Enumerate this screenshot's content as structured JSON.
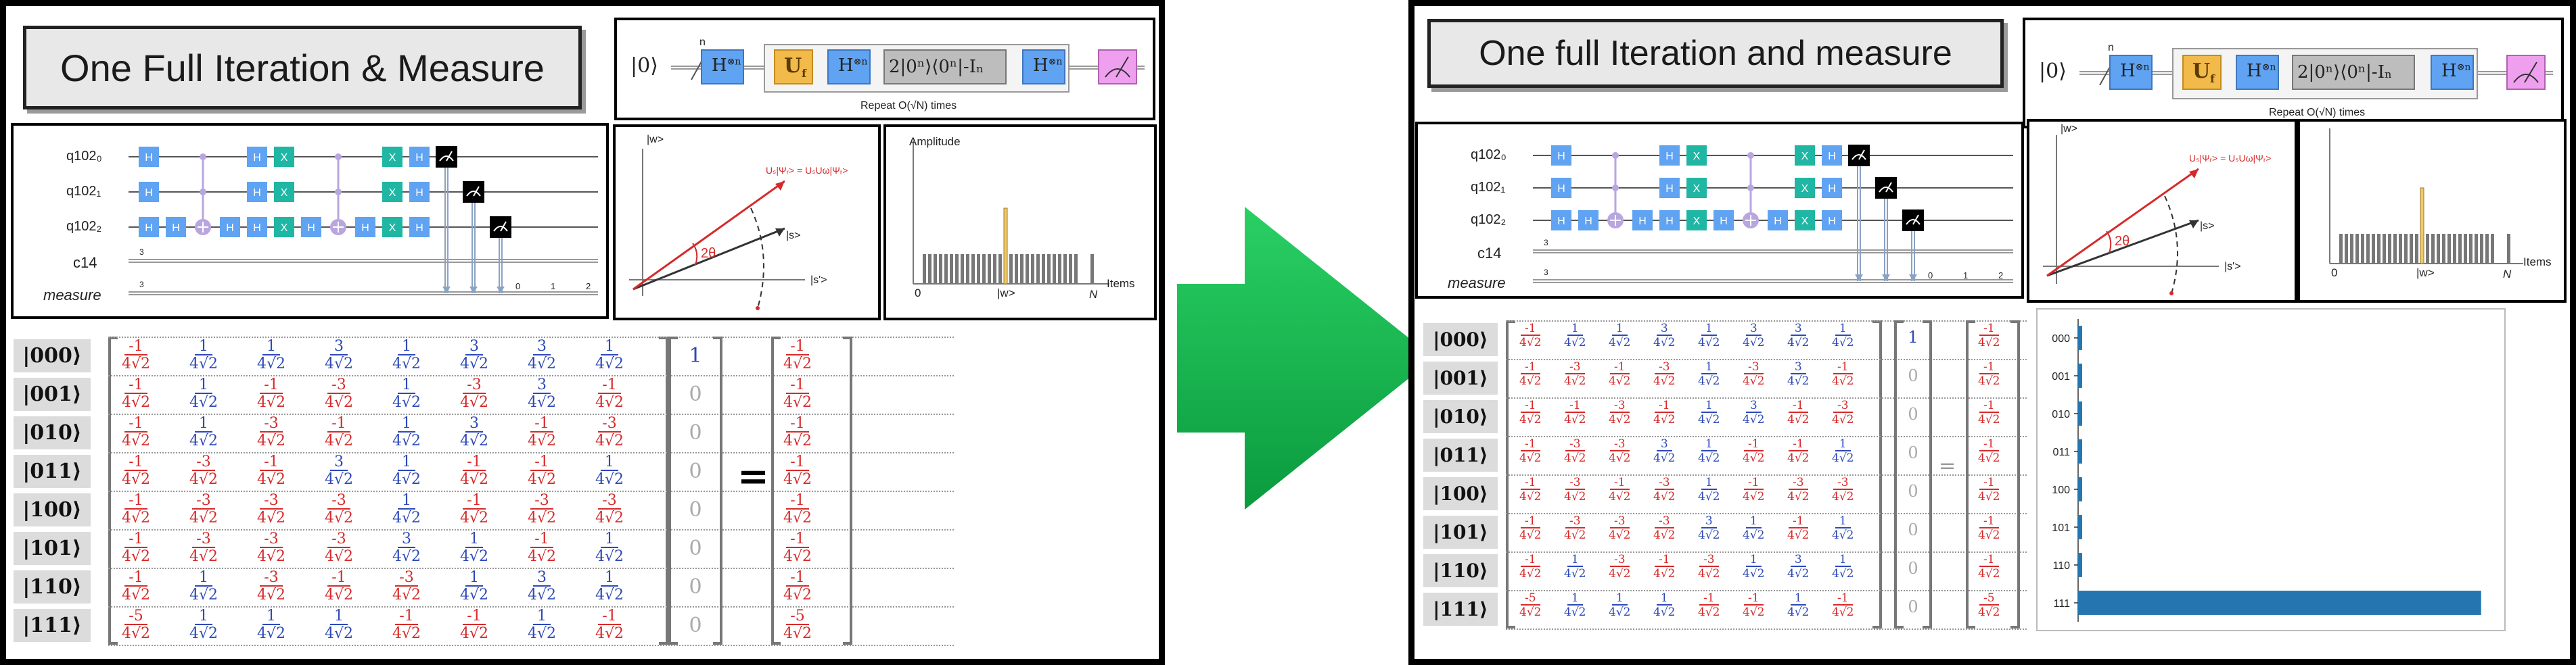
{
  "colors": {
    "arrow": "#12b34c",
    "gate_h": "#5fa3f2",
    "gate_x": "#1fb6a4",
    "uf_gate": "#f2b94b",
    "diffuser": "#bdbdbd",
    "measure_gate": "#eea0ee",
    "negative": "#d62a2a",
    "positive": "#2d49b8",
    "bar": "#2575b0",
    "marked_bar": "#f0c86a"
  },
  "left": {
    "title": "One Full Iteration & Measure",
    "top_circuit": {
      "ket0": "|0⟩",
      "n": "n",
      "h_label": "H",
      "h_sup": "⊗n",
      "uf": "U",
      "uf_sub": "f",
      "diffuser": "2|0ⁿ⟩⟨0ⁿ|-Iₙ",
      "repeat": "Repeat O(√N) times"
    },
    "circuit": {
      "qubits": [
        "q102₀",
        "q102₁",
        "q102₂"
      ],
      "classical": "c14",
      "measure": "measure",
      "bus_width": "3",
      "h": "H",
      "x": "X",
      "bit_labels": [
        "0",
        "1",
        "2"
      ]
    },
    "geometry_plot": {
      "w": "|w>",
      "s": "|s>",
      "s_prime": "|s'>",
      "angle": "2θ",
      "formula": "Uₛ|Ψᵣ> = UₛUω|Ψᵣ>"
    },
    "amplitude_plot": {
      "ylabel": "Amplitude",
      "origin": "0",
      "w_label": "|w>",
      "n_label": "N",
      "items_label": "Items"
    },
    "kets": [
      "|000⟩",
      "|001⟩",
      "|010⟩",
      "|011⟩",
      "|100⟩",
      "|101⟩",
      "|110⟩",
      "|111⟩"
    ],
    "matrix": [
      [
        "-1",
        "1",
        "1",
        "3",
        "1",
        "3",
        "3",
        "1"
      ],
      [
        "-1",
        "1",
        "-1",
        "-3",
        "1",
        "-3",
        "3",
        "-1"
      ],
      [
        "-1",
        "1",
        "-3",
        "-1",
        "1",
        "3",
        "-1",
        "-3"
      ],
      [
        "-1",
        "-3",
        "-1",
        "3",
        "1",
        "-1",
        "-1",
        "1"
      ],
      [
        "-1",
        "-3",
        "-3",
        "-3",
        "1",
        "-1",
        "-3",
        "-3"
      ],
      [
        "-1",
        "-3",
        "-3",
        "-3",
        "3",
        "1",
        "-1",
        "1"
      ],
      [
        "-1",
        "1",
        "-3",
        "-1",
        "-3",
        "1",
        "3",
        "1"
      ],
      [
        "-5",
        "1",
        "1",
        "1",
        "-1",
        "-1",
        "1",
        "-1"
      ]
    ],
    "den": "4√2",
    "vector": [
      "1",
      "0",
      "0",
      "0",
      "0",
      "0",
      "0",
      "0"
    ],
    "equals": "=",
    "result": [
      "-1",
      "-1",
      "-1",
      "-1",
      "-1",
      "-1",
      "-1",
      "-5"
    ]
  },
  "right": {
    "title": "One full Iteration and measure",
    "top_circuit": {
      "ket0": "|0⟩",
      "n": "n",
      "h_label": "H",
      "h_sup": "⊗n",
      "uf": "U",
      "uf_sub": "f",
      "diffuser": "2|0ⁿ⟩⟨0ⁿ|-Iₙ",
      "repeat": "Repeat O(√N) times"
    },
    "circuit": {
      "qubits": [
        "q102₀",
        "q102₁",
        "q102₂"
      ],
      "classical": "c14",
      "measure": "measure",
      "bus_width": "3",
      "h": "H",
      "x": "X",
      "bit_labels": [
        "0",
        "1",
        "2"
      ]
    },
    "geometry_plot": {
      "w": "|w>",
      "s": "|s>",
      "s_prime": "|s'>",
      "angle": "2θ",
      "formula": "Uₛ|Ψᵣ> = UₛUω|Ψᵣ>"
    },
    "amplitude_plot": {
      "origin": "0",
      "w_label": "|w>",
      "n_label": "N",
      "items_label": "Items"
    },
    "kets": [
      "|000⟩",
      "|001⟩",
      "|010⟩",
      "|011⟩",
      "|100⟩",
      "|101⟩",
      "|110⟩",
      "|111⟩"
    ],
    "matrix": [
      [
        "-1",
        "1",
        "1",
        "3",
        "1",
        "3",
        "3",
        "1"
      ],
      [
        "-1",
        "-3",
        "-1",
        "-3",
        "1",
        "-3",
        "3",
        "-1"
      ],
      [
        "-1",
        "-1",
        "-3",
        "-1",
        "1",
        "3",
        "-1",
        "-3"
      ],
      [
        "-1",
        "-3",
        "-3",
        "3",
        "1",
        "-1",
        "-1",
        "1"
      ],
      [
        "-1",
        "-3",
        "-1",
        "-3",
        "1",
        "-1",
        "-3",
        "-3"
      ],
      [
        "-1",
        "-3",
        "-3",
        "-3",
        "3",
        "1",
        "-1",
        "1"
      ],
      [
        "-1",
        "1",
        "-3",
        "-1",
        "-3",
        "1",
        "3",
        "1"
      ],
      [
        "-5",
        "1",
        "1",
        "1",
        "-1",
        "-1",
        "1",
        "-1"
      ]
    ],
    "den": "4√2",
    "vector": [
      "1",
      "0",
      "0",
      "0",
      "0",
      "0",
      "0",
      "0"
    ],
    "equals": "=",
    "result": [
      "-1",
      "-1",
      "-1",
      "-1",
      "-1",
      "-1",
      "-1",
      "-5"
    ]
  },
  "chart_data": {
    "type": "bar",
    "orientation": "horizontal",
    "categories": [
      "000",
      "001",
      "010",
      "011",
      "100",
      "101",
      "110",
      "111"
    ],
    "values": [
      0.0078,
      0.0078,
      0.0078,
      0.0078,
      0.0078,
      0.0078,
      0.0078,
      0.7813
    ]
  }
}
